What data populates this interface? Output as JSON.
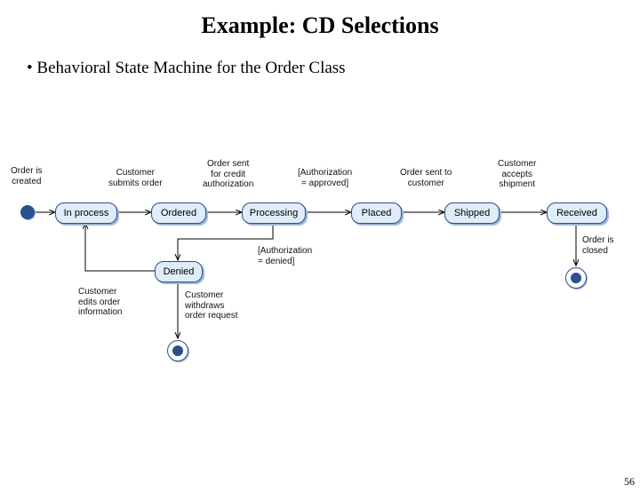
{
  "title": "Example: CD Selections",
  "bullet": "Behavioral State Machine for the Order Class",
  "labels": {
    "created": "Order is\ncreated",
    "submits": "Customer\nsubmits order",
    "sentCredit": "Order sent\nfor credit\nauthorization",
    "approved": "[Authorization\n= approved]",
    "sentCust": "Order sent to\ncustomer",
    "accepts": "Customer\naccepts\nshipment",
    "edits": "Customer\nedits order\ninformation",
    "withdraws": "Customer\nwithdraws\norder request",
    "denied": "[Authorization\n= denied]",
    "closed": "Order is\nclosed"
  },
  "states": {
    "inprocess": "In process",
    "ordered": "Ordered",
    "processing": "Processing",
    "placed": "Placed",
    "shipped": "Shipped",
    "received": "Received",
    "deniedState": "Denied"
  },
  "pagenum": "56",
  "chart_data": {
    "type": "state_machine",
    "title": "Behavioral State Machine for the Order Class",
    "initial_state": "start",
    "final_states": [
      "end_withdrawn",
      "end_closed"
    ],
    "states": [
      "In process",
      "Ordered",
      "Processing",
      "Placed",
      "Shipped",
      "Received",
      "Denied"
    ],
    "transitions": [
      {
        "from": "start",
        "to": "In process",
        "trigger": "Order is created"
      },
      {
        "from": "In process",
        "to": "Ordered",
        "trigger": "Customer submits order"
      },
      {
        "from": "Ordered",
        "to": "Processing",
        "trigger": "Order sent for credit authorization"
      },
      {
        "from": "Processing",
        "to": "Placed",
        "guard": "[Authorization = approved]"
      },
      {
        "from": "Placed",
        "to": "Shipped",
        "trigger": "Order sent to customer"
      },
      {
        "from": "Shipped",
        "to": "Received",
        "trigger": "Customer accepts shipment"
      },
      {
        "from": "Received",
        "to": "end_closed",
        "trigger": "Order is closed"
      },
      {
        "from": "Processing",
        "to": "Denied",
        "guard": "[Authorization = denied]"
      },
      {
        "from": "Denied",
        "to": "In process",
        "trigger": "Customer edits order information"
      },
      {
        "from": "Denied",
        "to": "end_withdrawn",
        "trigger": "Customer withdraws order request"
      }
    ]
  }
}
